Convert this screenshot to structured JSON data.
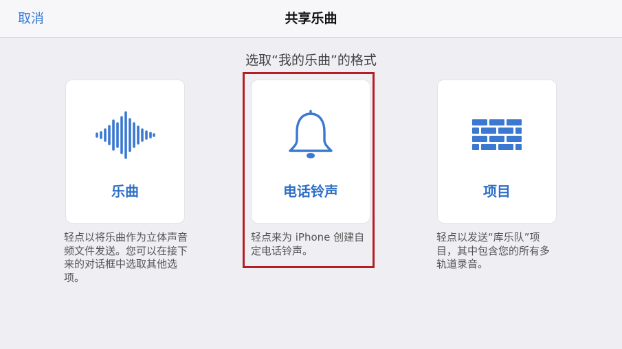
{
  "navbar": {
    "cancel_label": "取消",
    "title": "共享乐曲"
  },
  "prompt": "选取“我的乐曲”的格式",
  "options": [
    {
      "icon": "waveform-icon",
      "label": "乐曲",
      "description": "轻点以将乐曲作为立体声音频文件发送。您可以在接下来的对话框中选取其他选项。"
    },
    {
      "icon": "bell-icon",
      "label": "电话铃声",
      "description": "轻点来为 iPhone 创建自定电话铃声。"
    },
    {
      "icon": "brick-wall-icon",
      "label": "项目",
      "description": "轻点以发送“库乐队”项目，其中包含您的所有多轨道录音。"
    }
  ],
  "colors": {
    "accent": "#3478d6",
    "card_label": "#2f6fc6",
    "icon": "#3a78d2",
    "highlight": "#b51d25",
    "background": "#eeeef3"
  }
}
